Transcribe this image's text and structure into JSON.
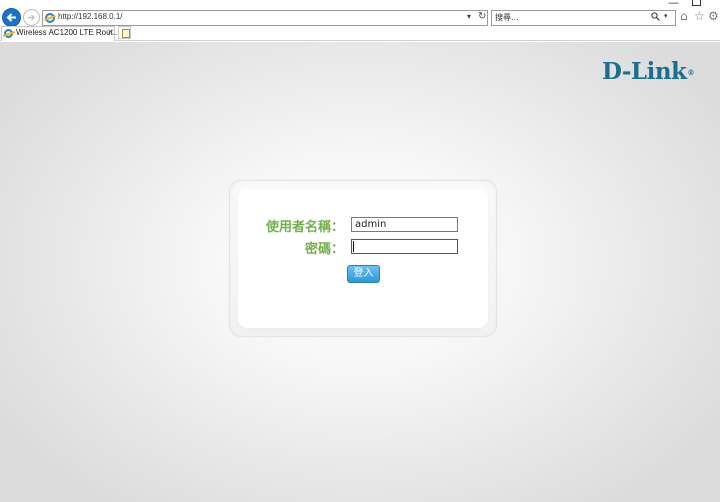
{
  "browser": {
    "url": "http://192.168.0.1/",
    "search_placeholder": "搜尋...",
    "tab_title": "Wireless AC1200 LTE Rout...",
    "tab_close": "×"
  },
  "page": {
    "logo_text": "D-Link",
    "logo_mark": "®",
    "username_label": "使用者名稱：",
    "password_label": "密碼：",
    "username_value": "admin",
    "password_value": "",
    "login_button": "登入"
  },
  "colors": {
    "label_green": "#73b04b",
    "logo_blue": "#1a6f8d",
    "button_blue": "#2a9ad8"
  }
}
